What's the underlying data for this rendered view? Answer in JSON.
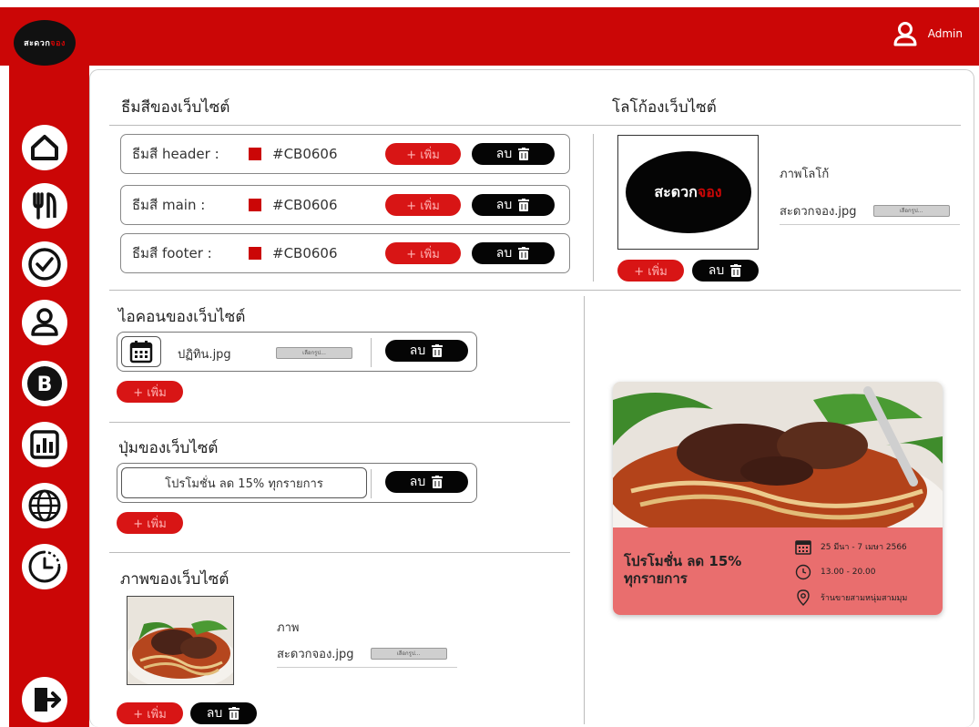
{
  "brand": {
    "logo_text_white": "สะดวก",
    "logo_text_red": "จอง",
    "primary_color": "#CB0606"
  },
  "header": {
    "user_label": "Admin"
  },
  "sidebar": {
    "icons": [
      "home-icon",
      "restaurant-icon",
      "check-circle-icon",
      "user-icon",
      "bitcoin-icon",
      "bar-chart-icon",
      "globe-icon",
      "clock-icon",
      "logout-icon"
    ]
  },
  "theme_section": {
    "title": "ธีมสีของเว็บไซต์",
    "rows": [
      {
        "label": "ธีมสี header :",
        "color": "#CB0606",
        "hex": "#CB0606"
      },
      {
        "label": "ธีมสี main :",
        "color": "#CB0606",
        "hex": "#CB0606"
      },
      {
        "label": "ธีมสี footer :",
        "color": "#CB0606",
        "hex": "#CB0606"
      }
    ],
    "add_label": "+ เพิ่ม",
    "delete_label": "ลบ"
  },
  "logo_section": {
    "title": "โลโก้องเว็บไซต์",
    "image_label": "ภาพโลโก้",
    "file_name": "สะดวกจอง.jpg",
    "file_button": "เลือกรูป...",
    "add_label": "+ เพิ่ม",
    "delete_label": "ลบ"
  },
  "icon_section": {
    "title": "ไอคอนของเว็บไซต์",
    "file_name": "ปฏิทิน.jpg",
    "file_button": "เลือกรูป...",
    "add_label": "+ เพิ่ม",
    "delete_label": "ลบ"
  },
  "button_section": {
    "title": "ปุ่มของเว็บไซต์",
    "button_text": "โปรโมชั่น ลด 15% ทุกรายการ",
    "add_label": "+ เพิ่ม",
    "delete_label": "ลบ"
  },
  "image_section": {
    "title": "ภาพของเว็บไซต์",
    "image_label": "ภาพ",
    "file_name": "สะดวกจอง.jpg",
    "file_button": "เลือกรูป...",
    "add_label": "+ เพิ่ม",
    "delete_label": "ลบ"
  },
  "promo_card": {
    "title_line1": "โปรโมชั่น ลด 15%",
    "title_line2": "ทุกรายการ",
    "date": "25 มีนา - 7 เมษา 2566",
    "time": "13.00 - 20.00",
    "location": "ร้านขายสามหนุ่มสามมุม"
  }
}
